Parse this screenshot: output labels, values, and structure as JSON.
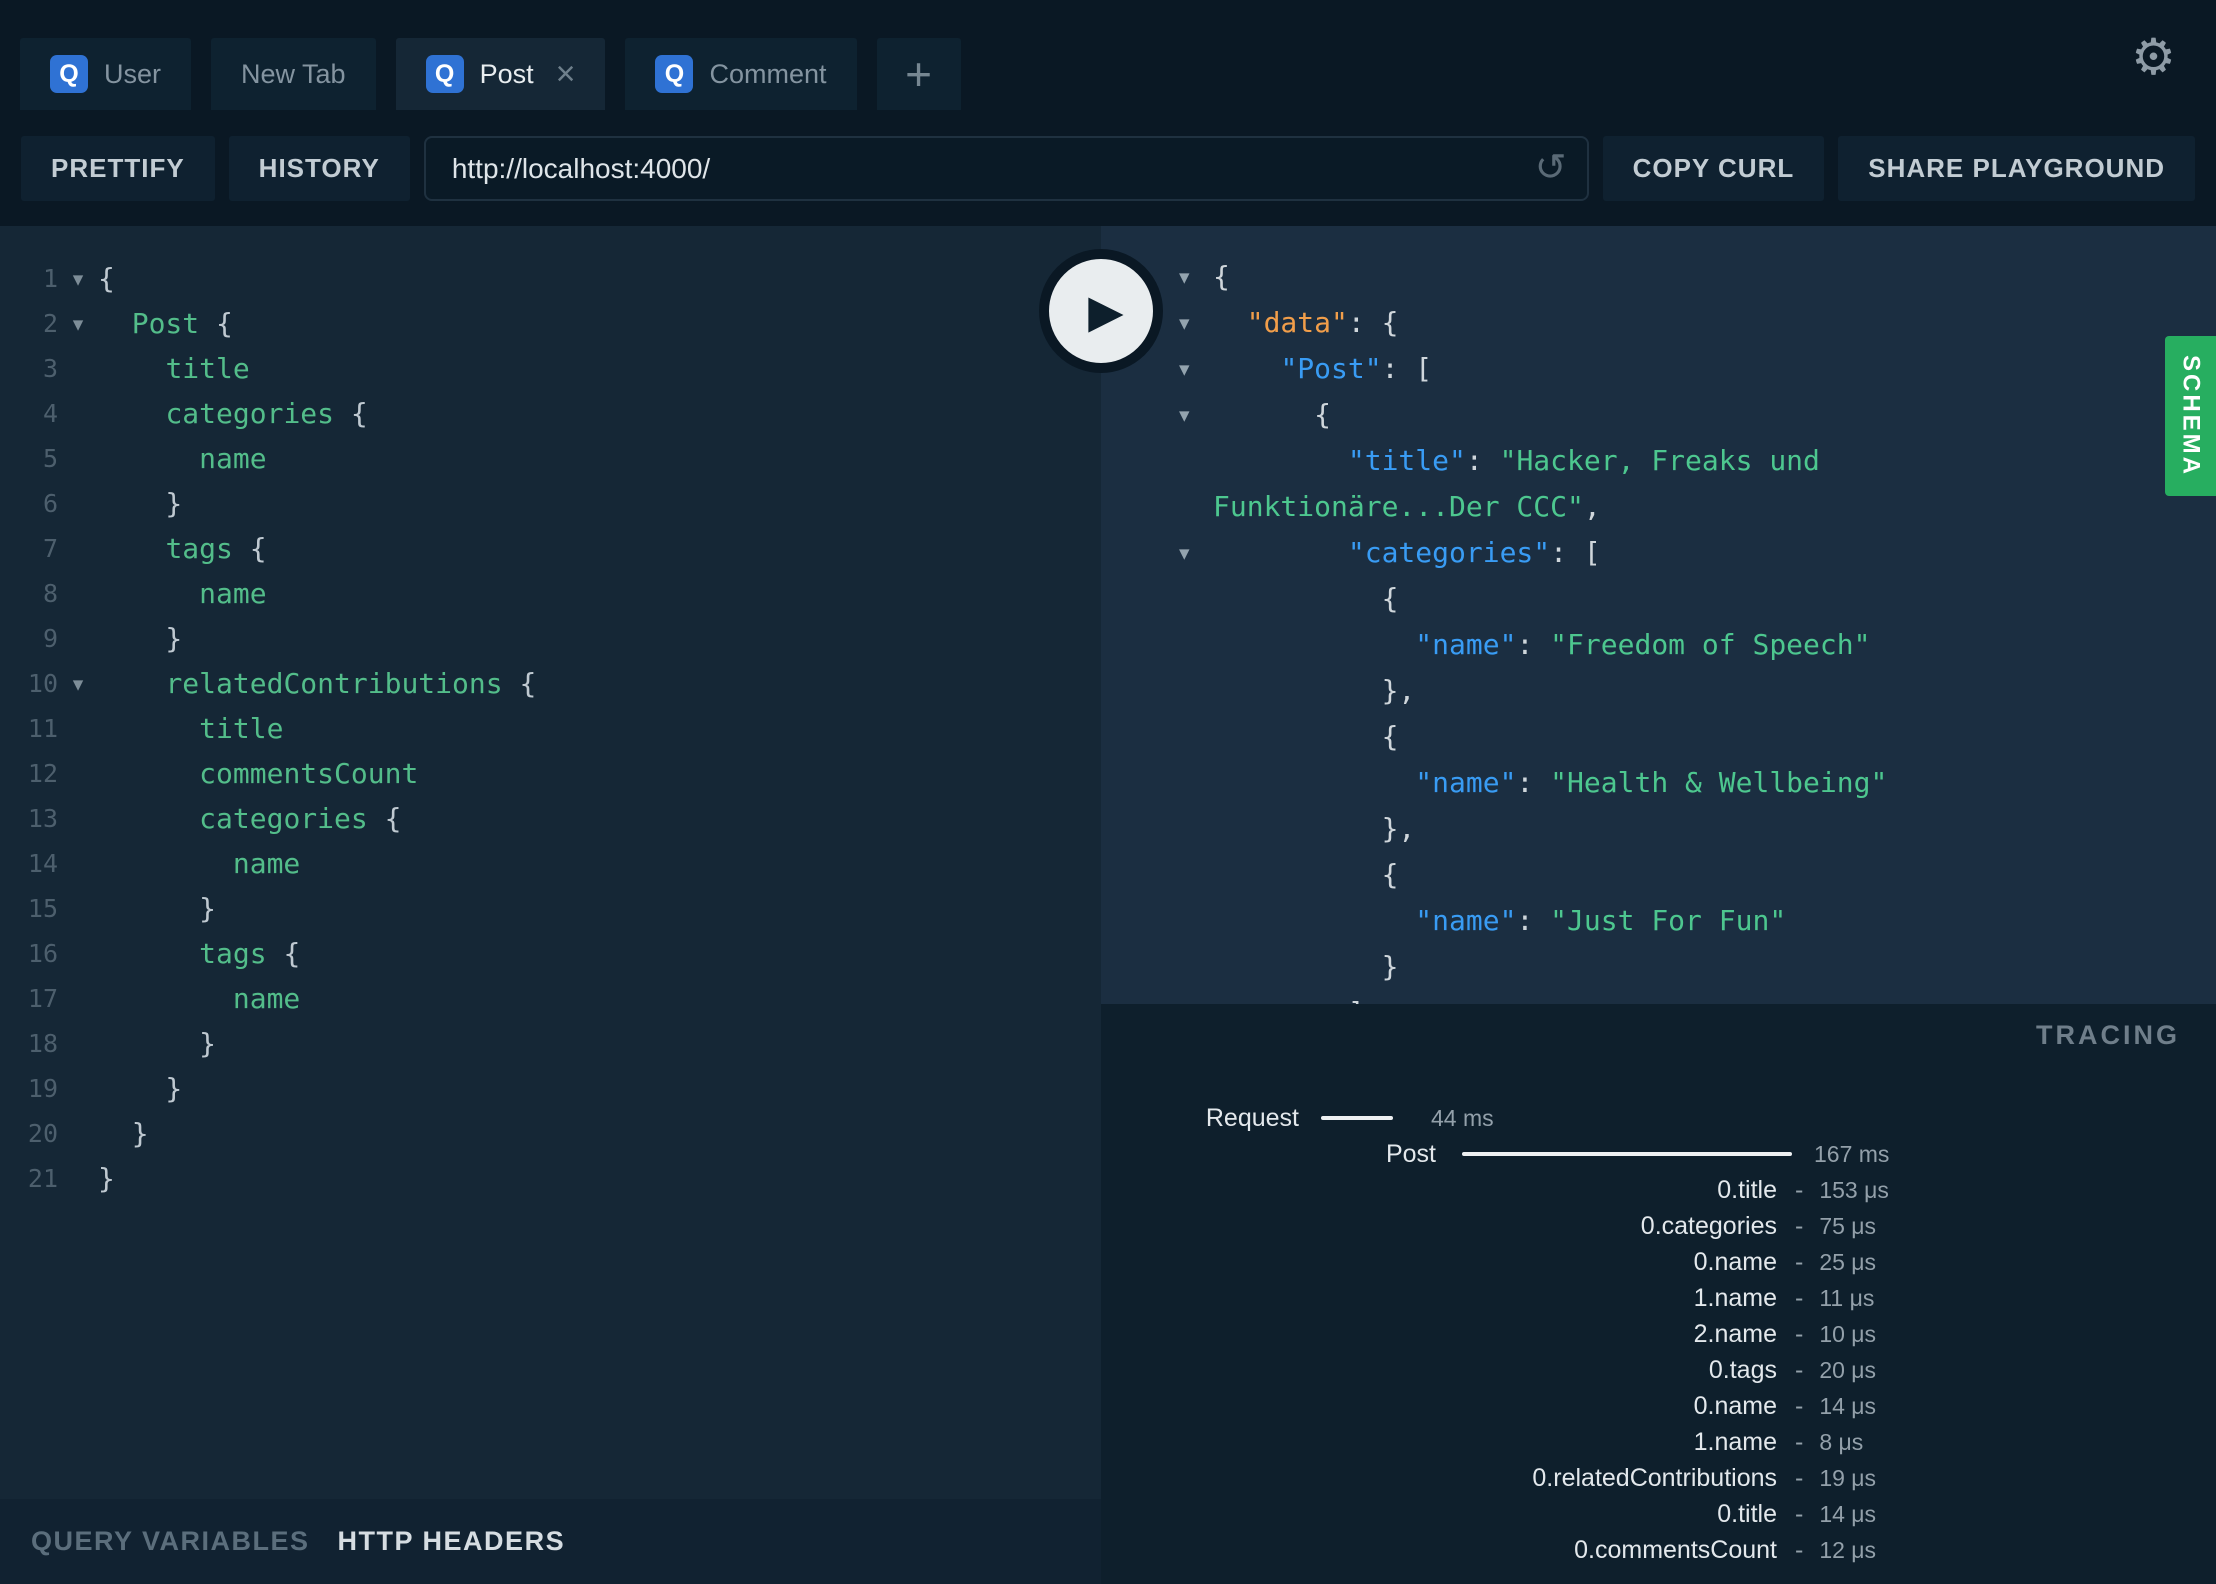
{
  "icons": {
    "query_tab": "Q",
    "gear": "⚙",
    "close": "×",
    "plus": "+",
    "reload": "↺",
    "play": "▶",
    "fold_open": "▾"
  },
  "colors": {
    "tab_icon_blue": "#2f72d4",
    "field_green": "#53bd8a",
    "key_blue": "#399cf4",
    "root_key_orange": "#f19e4a",
    "string_green": "#4dc78f",
    "schema_green": "#27ae60",
    "pane_left_bg": "#152736",
    "pane_right_bg": "#1b2e41",
    "chrome_bg": "#0a1824"
  },
  "tabs": {
    "items": [
      {
        "label": "User",
        "has_icon": true,
        "active": false,
        "closable": false
      },
      {
        "label": "New Tab",
        "has_icon": false,
        "active": false,
        "closable": false
      },
      {
        "label": "Post",
        "has_icon": true,
        "active": true,
        "closable": true
      },
      {
        "label": "Comment",
        "has_icon": true,
        "active": false,
        "closable": false
      }
    ]
  },
  "toolbar": {
    "prettify_label": "PRETTIFY",
    "history_label": "HISTORY",
    "url_value": "http://localhost:4000/",
    "copy_curl_label": "COPY CURL",
    "share_label": "SHARE PLAYGROUND"
  },
  "query_editor": {
    "lines": [
      {
        "n": 1,
        "fold": true,
        "t": [
          [
            "p",
            "{"
          ]
        ]
      },
      {
        "n": 2,
        "fold": true,
        "t": [
          [
            "p",
            "  "
          ],
          [
            "f",
            "Post"
          ],
          [
            "p",
            " {"
          ]
        ]
      },
      {
        "n": 3,
        "fold": false,
        "t": [
          [
            "p",
            "    "
          ],
          [
            "f",
            "title"
          ]
        ]
      },
      {
        "n": 4,
        "fold": false,
        "t": [
          [
            "p",
            "    "
          ],
          [
            "f",
            "categories"
          ],
          [
            "p",
            " {"
          ]
        ]
      },
      {
        "n": 5,
        "fold": false,
        "t": [
          [
            "p",
            "      "
          ],
          [
            "f",
            "name"
          ]
        ]
      },
      {
        "n": 6,
        "fold": false,
        "t": [
          [
            "p",
            "    }"
          ]
        ]
      },
      {
        "n": 7,
        "fold": false,
        "t": [
          [
            "p",
            "    "
          ],
          [
            "f",
            "tags"
          ],
          [
            "p",
            " {"
          ]
        ]
      },
      {
        "n": 8,
        "fold": false,
        "t": [
          [
            "p",
            "      "
          ],
          [
            "f",
            "name"
          ]
        ]
      },
      {
        "n": 9,
        "fold": false,
        "t": [
          [
            "p",
            "    }"
          ]
        ]
      },
      {
        "n": 10,
        "fold": true,
        "t": [
          [
            "p",
            "    "
          ],
          [
            "f",
            "relatedContributions"
          ],
          [
            "p",
            " {"
          ]
        ]
      },
      {
        "n": 11,
        "fold": false,
        "t": [
          [
            "p",
            "      "
          ],
          [
            "f",
            "title"
          ]
        ]
      },
      {
        "n": 12,
        "fold": false,
        "t": [
          [
            "p",
            "      "
          ],
          [
            "f",
            "commentsCount"
          ]
        ]
      },
      {
        "n": 13,
        "fold": false,
        "t": [
          [
            "p",
            "      "
          ],
          [
            "f",
            "categories"
          ],
          [
            "p",
            " {"
          ]
        ]
      },
      {
        "n": 14,
        "fold": false,
        "t": [
          [
            "p",
            "        "
          ],
          [
            "f",
            "name"
          ]
        ]
      },
      {
        "n": 15,
        "fold": false,
        "t": [
          [
            "p",
            "      }"
          ]
        ]
      },
      {
        "n": 16,
        "fold": false,
        "t": [
          [
            "p",
            "      "
          ],
          [
            "f",
            "tags"
          ],
          [
            "p",
            " {"
          ]
        ]
      },
      {
        "n": 17,
        "fold": false,
        "t": [
          [
            "p",
            "        "
          ],
          [
            "f",
            "name"
          ]
        ]
      },
      {
        "n": 18,
        "fold": false,
        "t": [
          [
            "p",
            "      }"
          ]
        ]
      },
      {
        "n": 19,
        "fold": false,
        "t": [
          [
            "p",
            "    }"
          ]
        ]
      },
      {
        "n": 20,
        "fold": false,
        "t": [
          [
            "p",
            "  }"
          ]
        ]
      },
      {
        "n": 21,
        "fold": false,
        "t": [
          [
            "p",
            "}"
          ]
        ]
      }
    ]
  },
  "response_viewer": {
    "lines": [
      {
        "fold": true,
        "t": [
          [
            "p",
            "{"
          ]
        ]
      },
      {
        "fold": true,
        "t": [
          [
            "p",
            "  "
          ],
          [
            "o",
            "\"data\""
          ],
          [
            "p",
            ": {"
          ]
        ]
      },
      {
        "fold": true,
        "t": [
          [
            "p",
            "    "
          ],
          [
            "k",
            "\"Post\""
          ],
          [
            "p",
            ": ["
          ]
        ]
      },
      {
        "fold": true,
        "t": [
          [
            "p",
            "      {"
          ]
        ]
      },
      {
        "fold": false,
        "t": [
          [
            "p",
            "        "
          ],
          [
            "k",
            "\"title\""
          ],
          [
            "p",
            ": "
          ],
          [
            "s",
            "\"Hacker, Freaks und Funktionäre...Der CCC\""
          ],
          [
            "p",
            ","
          ]
        ]
      },
      {
        "fold": true,
        "t": [
          [
            "p",
            "        "
          ],
          [
            "k",
            "\"categories\""
          ],
          [
            "p",
            ": ["
          ]
        ]
      },
      {
        "fold": false,
        "t": [
          [
            "p",
            "          {"
          ]
        ]
      },
      {
        "fold": false,
        "t": [
          [
            "p",
            "            "
          ],
          [
            "k",
            "\"name\""
          ],
          [
            "p",
            ": "
          ],
          [
            "s",
            "\"Freedom of Speech\""
          ]
        ]
      },
      {
        "fold": false,
        "t": [
          [
            "p",
            "          },"
          ]
        ]
      },
      {
        "fold": false,
        "t": [
          [
            "p",
            "          {"
          ]
        ]
      },
      {
        "fold": false,
        "t": [
          [
            "p",
            "            "
          ],
          [
            "k",
            "\"name\""
          ],
          [
            "p",
            ": "
          ],
          [
            "s",
            "\"Health & Wellbeing\""
          ]
        ]
      },
      {
        "fold": false,
        "t": [
          [
            "p",
            "          },"
          ]
        ]
      },
      {
        "fold": false,
        "t": [
          [
            "p",
            "          {"
          ]
        ]
      },
      {
        "fold": false,
        "t": [
          [
            "p",
            "            "
          ],
          [
            "k",
            "\"name\""
          ],
          [
            "p",
            ": "
          ],
          [
            "s",
            "\"Just For Fun\""
          ]
        ]
      },
      {
        "fold": false,
        "t": [
          [
            "p",
            "          }"
          ]
        ]
      },
      {
        "fold": false,
        "t": [
          [
            "p",
            "        ],"
          ]
        ]
      }
    ]
  },
  "schema_tab": {
    "label": "SCHEMA"
  },
  "tracing": {
    "title": "TRACING",
    "dash_char": "-",
    "rows": [
      {
        "type": "request",
        "label": "Request",
        "value": "44 ms"
      },
      {
        "type": "root",
        "label": "Post",
        "value": "167 ms"
      },
      {
        "type": "field",
        "label": "0.title",
        "value": "153 μs"
      },
      {
        "type": "field",
        "label": "0.categories",
        "value": "75 μs"
      },
      {
        "type": "field",
        "label": "0.name",
        "value": "25 μs"
      },
      {
        "type": "field",
        "label": "1.name",
        "value": "11 μs"
      },
      {
        "type": "field",
        "label": "2.name",
        "value": "10 μs"
      },
      {
        "type": "field",
        "label": "0.tags",
        "value": "20 μs"
      },
      {
        "type": "field",
        "label": "0.name",
        "value": "14 μs"
      },
      {
        "type": "field",
        "label": "1.name",
        "value": "8 μs"
      },
      {
        "type": "field",
        "label": "0.relatedContributions",
        "value": "19 μs"
      },
      {
        "type": "field",
        "label": "0.title",
        "value": "14 μs"
      },
      {
        "type": "field",
        "label": "0.commentsCount",
        "value": "12 μs"
      }
    ]
  },
  "bottom_bar": {
    "query_variables_label": "QUERY VARIABLES",
    "http_headers_label": "HTTP HEADERS"
  }
}
